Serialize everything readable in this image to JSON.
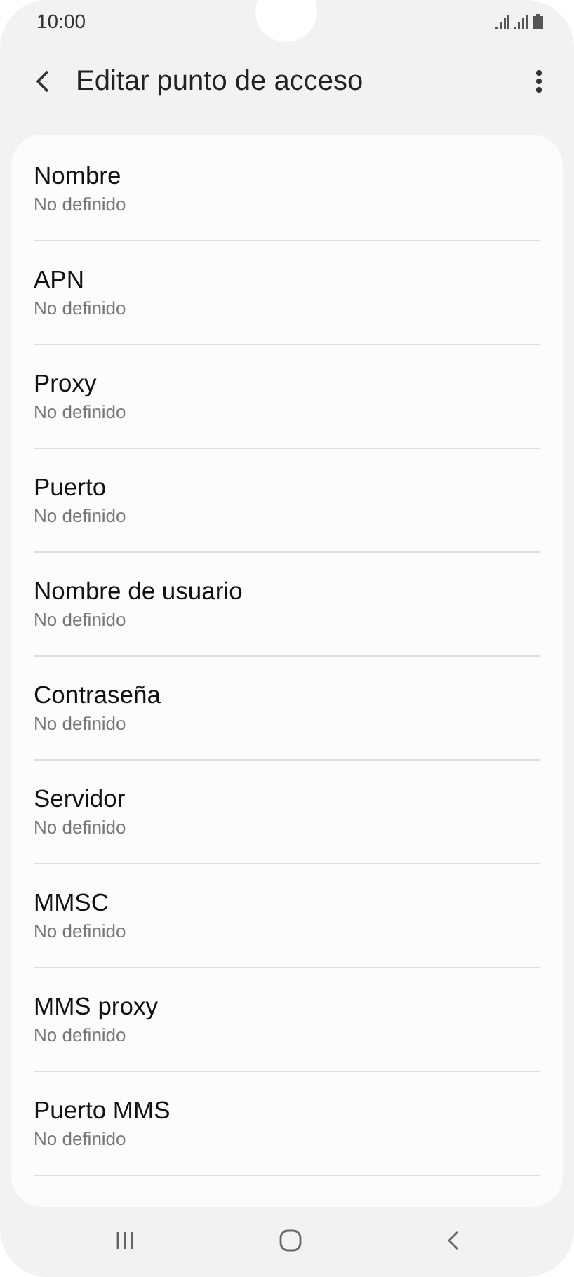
{
  "status_bar": {
    "time": "10:00"
  },
  "header": {
    "title": "Editar punto de acceso"
  },
  "items": [
    {
      "title": "Nombre",
      "value": "No definido"
    },
    {
      "title": "APN",
      "value": "No definido"
    },
    {
      "title": "Proxy",
      "value": "No definido"
    },
    {
      "title": "Puerto",
      "value": "No definido"
    },
    {
      "title": "Nombre de usuario",
      "value": "No definido"
    },
    {
      "title": "Contraseña",
      "value": "No definido"
    },
    {
      "title": "Servidor",
      "value": "No definido"
    },
    {
      "title": "MMSC",
      "value": "No definido"
    },
    {
      "title": "MMS proxy",
      "value": "No definido"
    },
    {
      "title": "Puerto MMS",
      "value": "No definido"
    }
  ]
}
